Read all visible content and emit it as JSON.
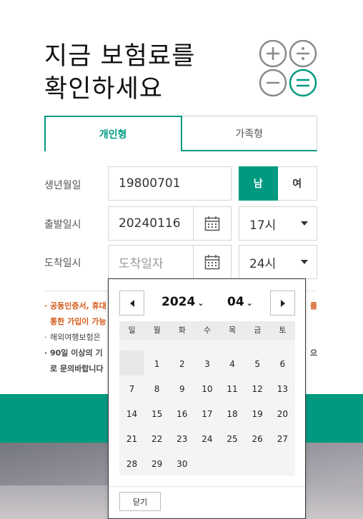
{
  "header": {
    "title_line1": "지금 보험료를",
    "title_line2": "확인하세요"
  },
  "colors": {
    "accent": "#009a80",
    "notice": "#d35a1a"
  },
  "tabs": [
    {
      "label": "개인형",
      "active": true
    },
    {
      "label": "가족형",
      "active": false
    }
  ],
  "form": {
    "birth": {
      "label": "생년월일",
      "value": "19800701"
    },
    "gender": {
      "male": "남",
      "female": "여",
      "selected": "남"
    },
    "departure": {
      "label": "출발일시",
      "value": "20240116",
      "hour": "17시"
    },
    "arrival": {
      "label": "도착일시",
      "placeholder": "도착일자",
      "hour": "24시"
    }
  },
  "notes": [
    {
      "lead": "공동인증서, 휴대",
      "tail": "를"
    },
    {
      "lead": "통한 가입이 가능"
    },
    {
      "lead": "해외여행보험은"
    },
    {
      "lead": "90일 이상의 기",
      "tail": "으"
    },
    {
      "lead": "로 문의바랍니다"
    }
  ],
  "datepicker": {
    "year": "2024",
    "month": "04",
    "weekdays": [
      "일",
      "월",
      "화",
      "수",
      "목",
      "금",
      "토"
    ],
    "first_weekday_index": 1,
    "days_in_month": 30,
    "close_label": "닫기"
  }
}
